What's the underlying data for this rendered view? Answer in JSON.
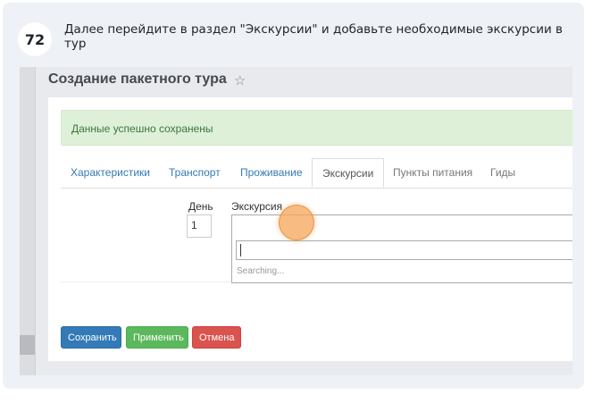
{
  "step": {
    "number": "72",
    "instruction": "Далее перейдите в раздел \"Экскурсии\" и добавьте необходимые экскурсии в тур"
  },
  "page": {
    "title": "Создание пакетного тура",
    "star_icon": "star-icon"
  },
  "alert": {
    "message": "Данные успешно сохранены",
    "color": "#dff0d8"
  },
  "tabs": [
    {
      "label": "Характеристики"
    },
    {
      "label": "Транспорт"
    },
    {
      "label": "Проживание"
    },
    {
      "label": "Экскурсии",
      "active": true
    },
    {
      "label": "Пункты питания"
    },
    {
      "label": "Гиды"
    }
  ],
  "form": {
    "day_label": "День",
    "day_value": "1",
    "excursion_label": "Экскурсия",
    "searching_text": "Searching..."
  },
  "buttons": {
    "save": "Сохранить",
    "apply": "Применить",
    "cancel": "Отмена"
  },
  "colors": {
    "primary": "#337ab7",
    "success": "#5cb85c",
    "danger": "#d9534f",
    "click_marker": "#f5a65a"
  }
}
